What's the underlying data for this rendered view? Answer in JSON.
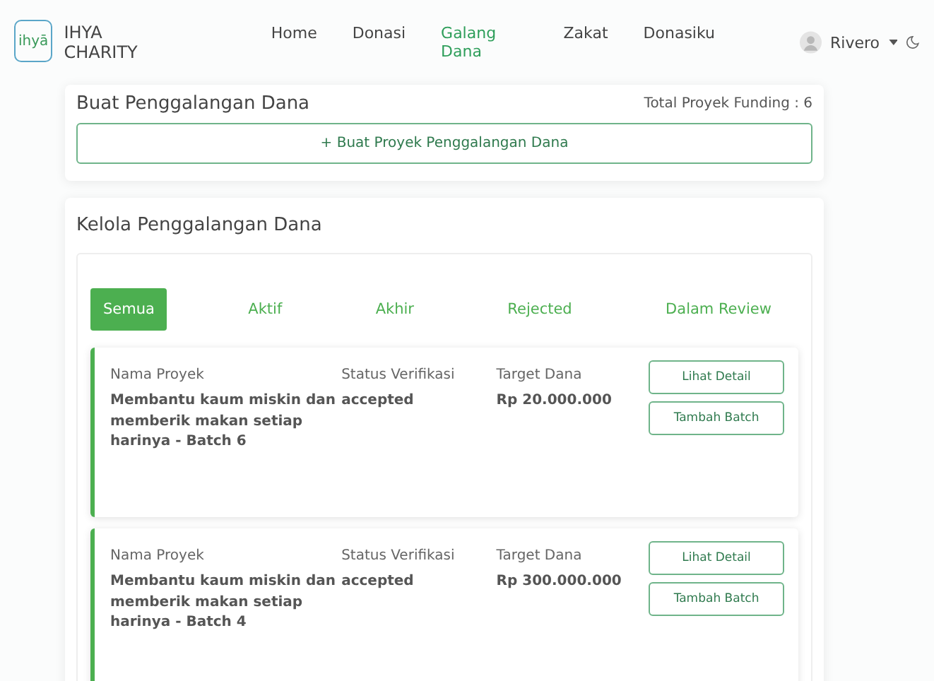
{
  "brand": {
    "logo": "ihyā",
    "name": "IHYA CHARITY"
  },
  "nav": [
    {
      "label": "Home",
      "selected": false
    },
    {
      "label": "Donasi",
      "selected": false
    },
    {
      "label": "Galang Dana",
      "selected": true
    },
    {
      "label": "Zakat",
      "selected": false
    },
    {
      "label": "Donasiku",
      "selected": false
    }
  ],
  "user": {
    "name": "Rivero"
  },
  "create_card": {
    "title": "Buat Penggalangan Dana",
    "total": "Total Proyek Funding : 6",
    "button": "+ Buat Proyek Penggalangan Dana"
  },
  "manage_card": {
    "title": "Kelola Penggalangan Dana"
  },
  "tabs": [
    {
      "label": "Semua",
      "selected": true
    },
    {
      "label": "Aktif",
      "selected": false
    },
    {
      "label": "Akhir",
      "selected": false
    },
    {
      "label": "Rejected",
      "selected": false
    },
    {
      "label": "Dalam Review",
      "selected": false
    }
  ],
  "projects": [
    {
      "name_label": "Nama Proyek",
      "name": "Membantu kaum miskin dan memberik makan setiap harinya - Batch 6",
      "status_label": "Status Verifikasi",
      "status": "accepted",
      "target_label": "Target Dana",
      "target": "Rp 20.000.000",
      "buttons": [
        "Lihat Detail",
        "Tambah Batch"
      ]
    },
    {
      "name_label": "Nama Proyek",
      "name": "Membantu kaum miskin dan memberik makan setiap harinya - Batch 4",
      "status_label": "Status Verifikasi",
      "status": "accepted",
      "target_label": "Target Dana",
      "target": "Rp 300.000.000",
      "buttons": [
        "Lihat Detail",
        "Tambah Batch"
      ]
    }
  ]
}
